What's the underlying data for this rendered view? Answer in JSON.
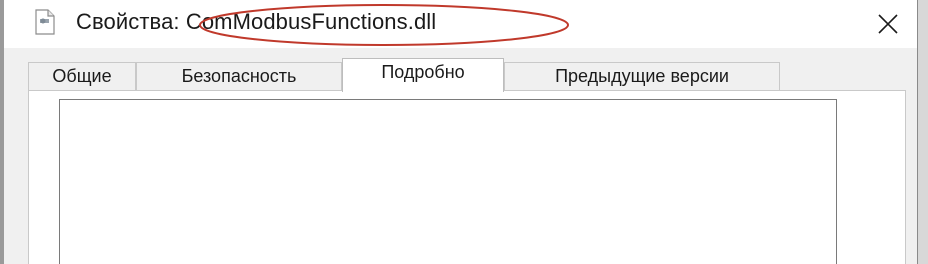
{
  "window": {
    "title": "Свойства: ComModbusFunctions.dll",
    "close_icon": "close-icon",
    "app_icon": "file-properties-icon",
    "annotation_color": "#c0392b"
  },
  "tabs": [
    {
      "label": "Общие",
      "active": false
    },
    {
      "label": "Безопасность",
      "active": false
    },
    {
      "label": "Подробно",
      "active": true
    },
    {
      "label": "Предыдущие версии",
      "active": false
    }
  ]
}
